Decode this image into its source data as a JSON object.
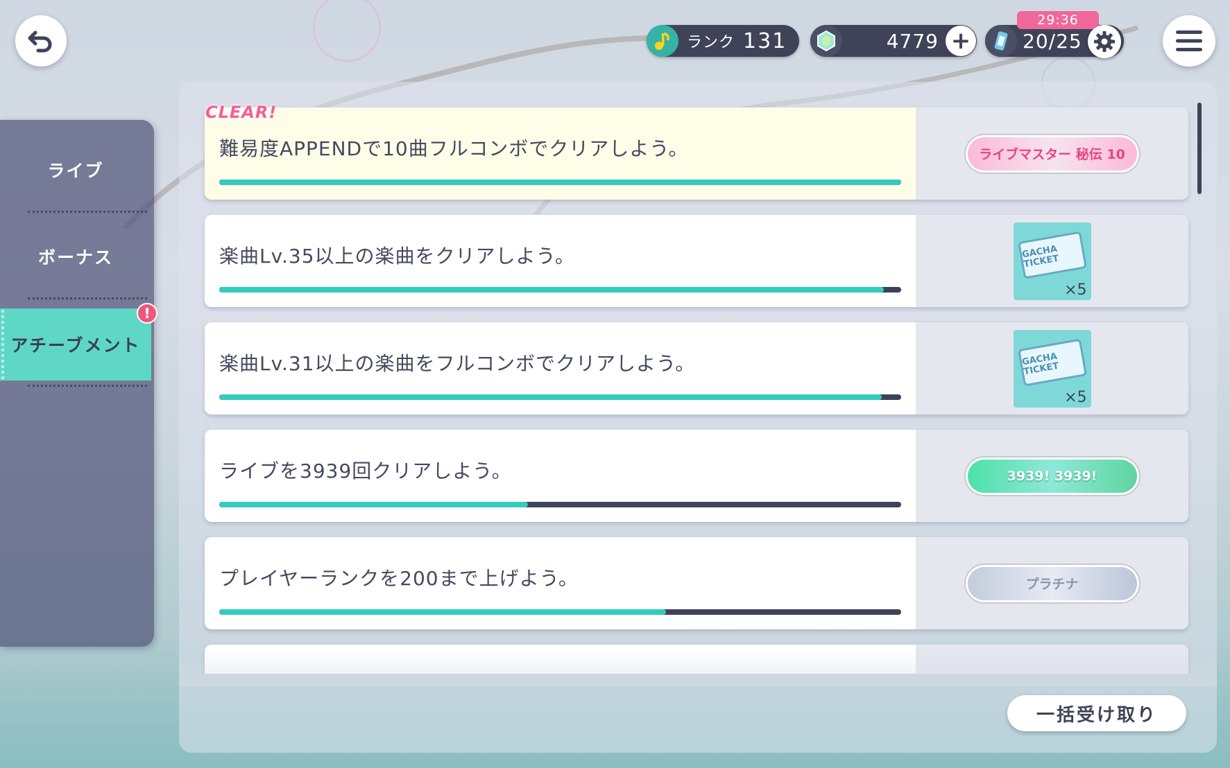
{
  "header": {
    "rank_label": "ランク",
    "rank_value": "131",
    "gems": "4779",
    "timer": "29:36",
    "energy": "20/25"
  },
  "sidebar": {
    "tabs": [
      {
        "label": "ライブ",
        "active": false
      },
      {
        "label": "ボーナス",
        "active": false
      },
      {
        "label": "アチーブメント",
        "active": true
      }
    ],
    "alert": "!"
  },
  "missions": [
    {
      "text": "難易度APPENDで10曲フルコンボでクリアしよう。",
      "progress": 1.0,
      "cleared": true,
      "reward": {
        "type": "banner",
        "label": "ライブマスター 秘伝 10"
      }
    },
    {
      "text": "楽曲Lv.35以上の楽曲をクリアしよう。",
      "progress": 0.975,
      "cleared": false,
      "reward": {
        "type": "ticket",
        "label": "GACHA TICKET",
        "qty": "×5"
      }
    },
    {
      "text": "楽曲Lv.31以上の楽曲をフルコンボでクリアしよう。",
      "progress": 0.972,
      "cleared": false,
      "reward": {
        "type": "ticket",
        "label": "GACHA TICKET",
        "qty": "×5"
      }
    },
    {
      "text": "ライブを3939回クリアしよう。",
      "progress": 0.453,
      "cleared": false,
      "reward": {
        "type": "banner",
        "label": "3939! 3939!"
      }
    },
    {
      "text": "プレイヤーランクを200まで上げよう。",
      "progress": 0.655,
      "cleared": false,
      "reward": {
        "type": "banner",
        "label": "プラチナ"
      }
    }
  ],
  "clear_stamp": "CLEAR!",
  "collect_all_label": "一括受け取り",
  "colors": {
    "accent": "#33ccbc",
    "dark": "#3e4259",
    "pink": "#f0679a"
  }
}
